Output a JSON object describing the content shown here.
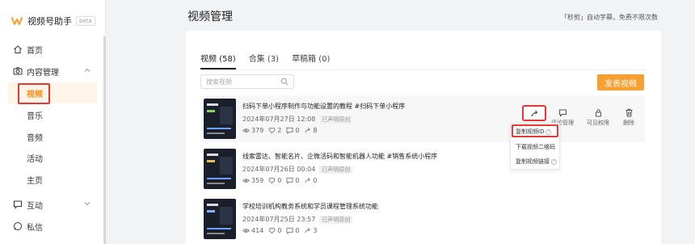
{
  "app": {
    "name": "视频号助手",
    "badge": "beta"
  },
  "sidebar": {
    "home": "首页",
    "content_mgmt": "内容管理",
    "sub_items": [
      "视频",
      "音乐",
      "音频",
      "活动",
      "主页"
    ],
    "interaction": "互动",
    "messages": "私信"
  },
  "header": {
    "title": "视频管理",
    "note": "「秒剪」自动字幕，免费不限次数"
  },
  "tabs": [
    {
      "label": "视频 (58)"
    },
    {
      "label": "合集 (3)"
    },
    {
      "label": "草稿箱 (0)"
    }
  ],
  "search": {
    "placeholder": "搜索视频"
  },
  "publish_button": "发表视频",
  "videos": [
    {
      "title": "扫码下单小程序制作与功能设置的教程 #扫码下单小程序",
      "date": "2024年07月27日 12:08",
      "badge": "已声明原创",
      "views": "379",
      "likes": "2",
      "comments": "0",
      "shares": "8"
    },
    {
      "title": "线索雷达、智能名片、企微活码和智能机器人功能 #销售系统小程序",
      "date": "2024年07月26日 00:04",
      "badge": "已声明原创",
      "views": "359",
      "likes": "0",
      "comments": "0",
      "shares": "0"
    },
    {
      "title": "学校培训机构教务系统和学员课程管理系统功能",
      "date": "2024年07月25日 23:57",
      "badge": "已声明原创",
      "views": "414",
      "likes": "0",
      "comments": "0",
      "shares": "3"
    }
  ],
  "row_actions": {
    "comments": "评论管理",
    "visibility": "可见权限",
    "delete": "删除"
  },
  "dropdown": [
    "复制视频ID",
    "下载视频二维码",
    "复制视频链接"
  ],
  "colors": {
    "accent": "#fa8c16",
    "button": "#f7a031",
    "highlight": "#e53935"
  }
}
